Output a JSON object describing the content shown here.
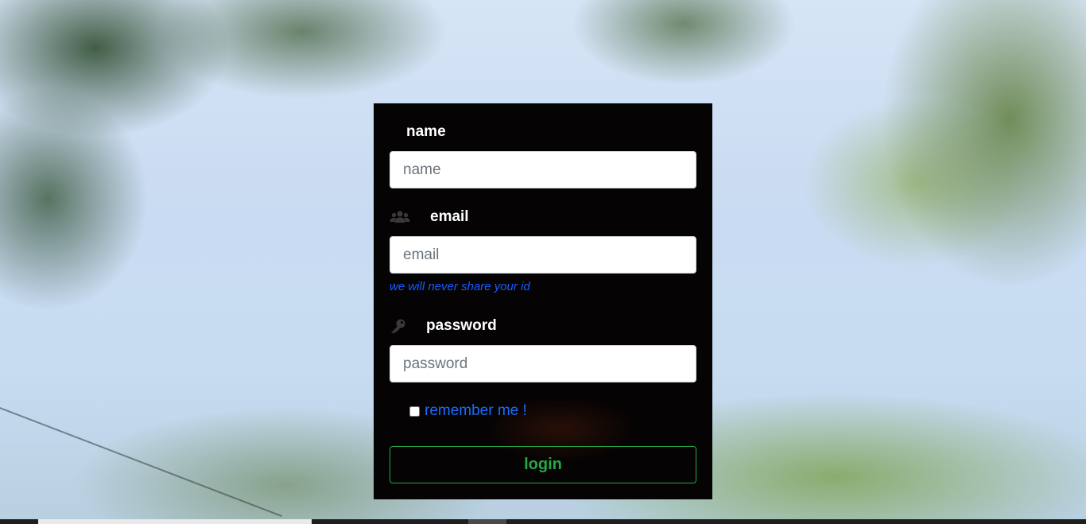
{
  "form": {
    "name": {
      "label": "name",
      "placeholder": "name",
      "value": ""
    },
    "email": {
      "label": "email",
      "placeholder": "email",
      "value": "",
      "help_text": "we will never share your id",
      "icon": "users-icon"
    },
    "password": {
      "label": "password",
      "placeholder": "password",
      "value": "",
      "icon": "key-icon"
    },
    "remember": {
      "label": "remember me !",
      "checked": false
    },
    "submit_label": "login"
  },
  "colors": {
    "card_background": "#050303",
    "help_text": "#1a5cff",
    "submit_accent": "#28a745"
  }
}
